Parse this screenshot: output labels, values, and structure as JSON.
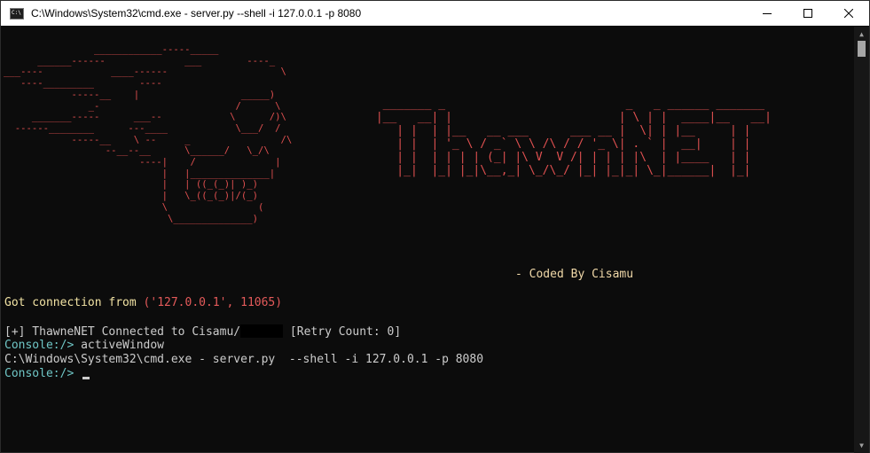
{
  "window": {
    "title": "C:\\Windows\\System32\\cmd.exe - server.py  --shell -i 127.0.0.1 -p 8080",
    "app_icon": "cmd-icon",
    "controls": [
      "minimize",
      "maximize",
      "close"
    ]
  },
  "banner": {
    "left_art": "                ____________-----_____\n      ______------              ___        ----_\n___----            ____------                    \\\n   ----_________        ----\n            -----__    |                  _____)\n               _-                        /      \\\n     _______-----      ___--            \\      /)\\\n  ------________      ---____            \\___/  /\n            -----__    \\ --     _                /\\\n                  --__--__      \\______/   \\_/\\\n                        ----|    /              |\n                            |   |______________|\n                            |   | ((_(_)| )_)\n                            |   \\_((_(_)|/(_)\n                            \\                (\n                             \\______________)",
    "right_art": "  _______ _                          _   _ ______ _______\n |__   __| |                        | \\ | |  ____|__   __|\n    | |  | |__   __ ___      ___ __ |  \\| | |__     | |\n    | |  | '_ \\ / _` \\ \\ /\\ / / '_ \\| . ` |  __|    | |\n    | |  | | | | (_| |\\ V  V /| | | | |\\  | |____   | |\n    |_|  |_| |_|\\__,_| \\_/\\_/ |_| |_|_| \\_|______|  |_|",
    "credit": "- Coded By Cisamu"
  },
  "output": {
    "connection_prefix": "Got connection from ",
    "connection_tuple": "('127.0.0.1', 11065)",
    "connected_msg": "[+] ThawneNET Connected to Cisamu/",
    "retry_msg": " [Retry Count: 0]",
    "prompt": "Console:/> ",
    "command": "activeWindow",
    "result": "C:\\Windows\\System32\\cmd.exe - server.py  --shell -i 127.0.0.1 -p 8080",
    "prompt2": "Console:/> "
  }
}
